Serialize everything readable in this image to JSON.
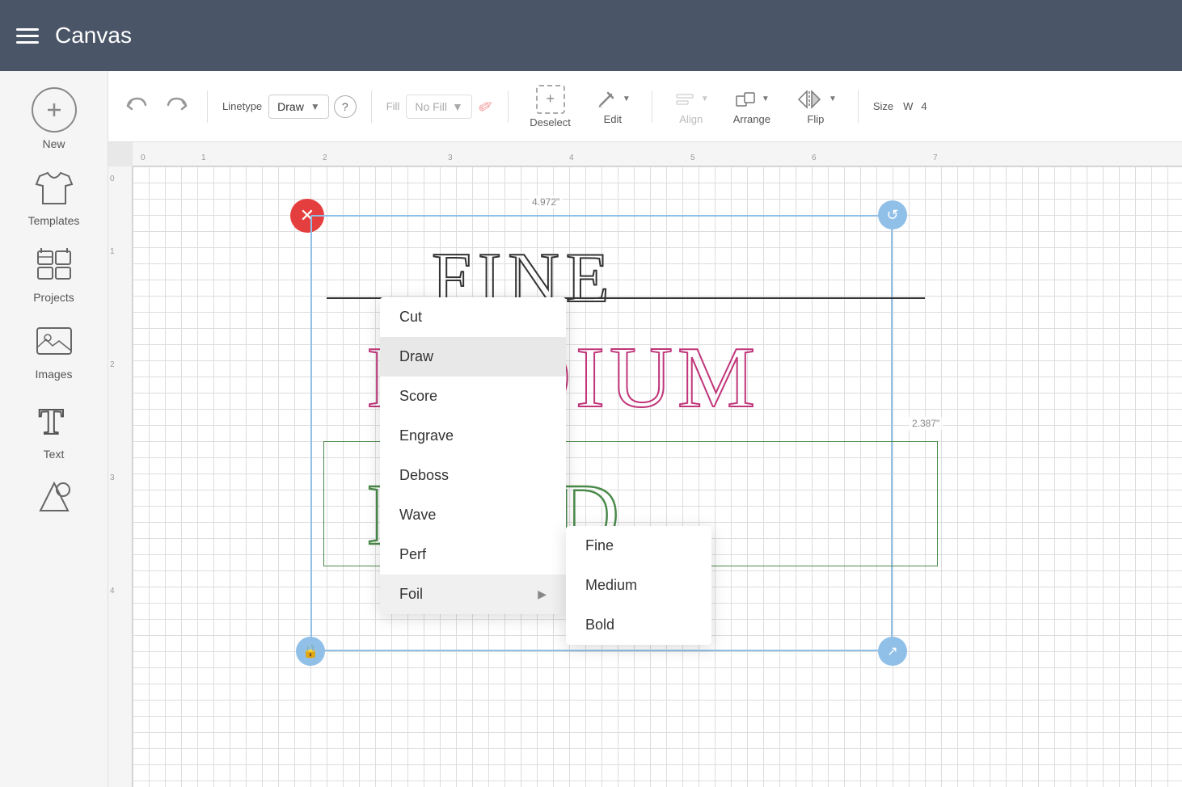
{
  "header": {
    "title": "Canvas",
    "menu_icon_label": "menu"
  },
  "sidebar": {
    "items": [
      {
        "id": "new",
        "label": "New",
        "icon": "plus-circle"
      },
      {
        "id": "templates",
        "label": "Templates",
        "icon": "tshirt"
      },
      {
        "id": "projects",
        "label": "Projects",
        "icon": "projects"
      },
      {
        "id": "images",
        "label": "Images",
        "icon": "images"
      },
      {
        "id": "text",
        "label": "Text",
        "icon": "text"
      },
      {
        "id": "shapes",
        "label": "Shapes",
        "icon": "shapes"
      }
    ]
  },
  "toolbar": {
    "linetype_label": "Linetype",
    "linetype_value": "Draw",
    "fill_label": "Fill",
    "fill_value": "No Fill",
    "question_label": "?",
    "deselect_label": "Deselect",
    "edit_label": "Edit",
    "align_label": "Align",
    "arrange_label": "Arrange",
    "flip_label": "Flip",
    "size_label": "Size",
    "size_w_label": "W",
    "size_value": "4"
  },
  "dropdown_menu": {
    "items": [
      {
        "id": "cut",
        "label": "Cut",
        "has_submenu": false
      },
      {
        "id": "draw",
        "label": "Draw",
        "has_submenu": false,
        "active": true
      },
      {
        "id": "score",
        "label": "Score",
        "has_submenu": false
      },
      {
        "id": "engrave",
        "label": "Engrave",
        "has_submenu": false
      },
      {
        "id": "deboss",
        "label": "Deboss",
        "has_submenu": false
      },
      {
        "id": "wave",
        "label": "Wave",
        "has_submenu": false
      },
      {
        "id": "perf",
        "label": "Perf",
        "has_submenu": false
      },
      {
        "id": "foil",
        "label": "Foil",
        "has_submenu": true
      }
    ],
    "submenu": {
      "items": [
        {
          "id": "fine",
          "label": "Fine"
        },
        {
          "id": "medium",
          "label": "Medium"
        },
        {
          "id": "bold",
          "label": "Bold"
        }
      ]
    }
  },
  "canvas": {
    "dim_width": "4.972\"",
    "dim_height": "2.387\"",
    "text_fine": "FINE",
    "text_medium": "EDIUM",
    "text_medium_prefix": "M",
    "text_bold": "BOLD",
    "ruler_numbers_h": [
      "0",
      "1",
      "2",
      "3",
      "4",
      "5",
      "6",
      "7"
    ],
    "ruler_numbers_v": [
      "0",
      "1",
      "2",
      "3",
      "4"
    ]
  }
}
